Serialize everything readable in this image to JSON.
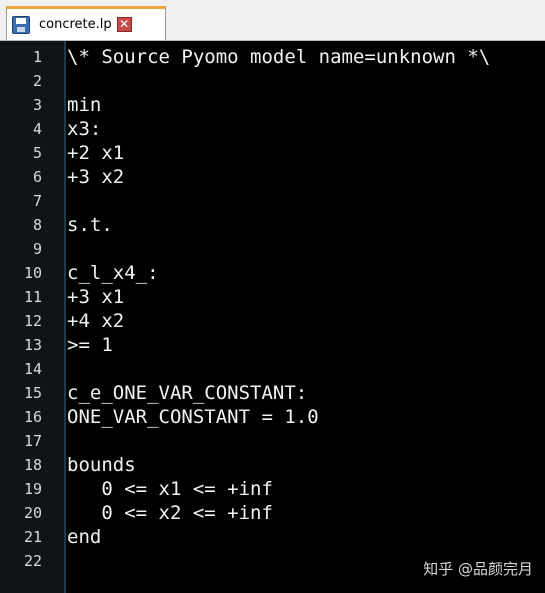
{
  "tab": {
    "title": "concrete.lp",
    "icon": "save-icon",
    "close_glyph": "✕"
  },
  "colors": {
    "tab_accent": "#f2a53a",
    "editor_background": "#000000",
    "gutter_background": "#101419",
    "text": "#f2f2f2"
  },
  "editor": {
    "lines": [
      {
        "number": "1",
        "text": "\\* Source Pyomo model name=unknown *\\"
      },
      {
        "number": "2",
        "text": ""
      },
      {
        "number": "3",
        "text": "min"
      },
      {
        "number": "4",
        "text": "x3:"
      },
      {
        "number": "5",
        "text": "+2 x1"
      },
      {
        "number": "6",
        "text": "+3 x2"
      },
      {
        "number": "7",
        "text": ""
      },
      {
        "number": "8",
        "text": "s.t."
      },
      {
        "number": "9",
        "text": ""
      },
      {
        "number": "10",
        "text": "c_l_x4_:"
      },
      {
        "number": "11",
        "text": "+3 x1"
      },
      {
        "number": "12",
        "text": "+4 x2"
      },
      {
        "number": "13",
        "text": ">= 1"
      },
      {
        "number": "14",
        "text": ""
      },
      {
        "number": "15",
        "text": "c_e_ONE_VAR_CONSTANT:"
      },
      {
        "number": "16",
        "text": "ONE_VAR_CONSTANT = 1.0"
      },
      {
        "number": "17",
        "text": ""
      },
      {
        "number": "18",
        "text": "bounds"
      },
      {
        "number": "19",
        "text": "   0 <= x1 <= +inf"
      },
      {
        "number": "20",
        "text": "   0 <= x2 <= +inf"
      },
      {
        "number": "21",
        "text": "end"
      },
      {
        "number": "22",
        "text": ""
      }
    ]
  },
  "watermark": "知乎 @品颜完月"
}
